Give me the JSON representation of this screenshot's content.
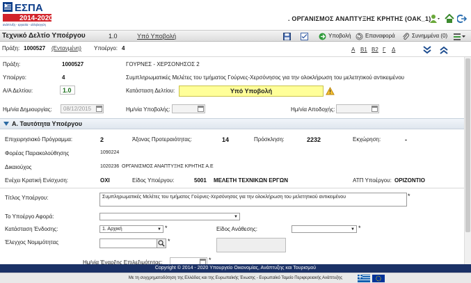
{
  "header": {
    "logo_text": "ΕΣΠΑ",
    "logo_years": "2014-2020",
    "logo_tagline": "ανάπτυξη - εργασία - αλληλεγγύη",
    "org_name": ". ΟΡΓΑΝΙΣΜΟΣ ΑΝΑΠΤΥΞΗΣ ΚΡΗΤΗΣ (OAK_1)",
    "icons": [
      "user-dropdown-icon",
      "home-icon",
      "logout-icon"
    ]
  },
  "toolbar": {
    "title": "Τεχνικό Δελτίο Υποέργου",
    "version": "1.0",
    "status_link": "Υπό Υποβολή",
    "submit_label": "Υποβολή",
    "resubmit_label": "Επαναφορά",
    "attachments_label": "Συνημμένα (0)"
  },
  "infobar": {
    "praxi_label": "Πράξη:",
    "praxi_value": "1000527",
    "praxi_link": "(Εντανμένη)",
    "ypoergo_label": "Υποέργο:",
    "ypoergo_value": "4",
    "section_links": [
      "A",
      "B1",
      "B2",
      "Γ",
      "Δ"
    ]
  },
  "details": {
    "praxi_label": "Πράξη:",
    "praxi_value": "1000527",
    "praxi_title": "ΓΟΥΡΝΕΣ - ΧΕΡΣΟΝΗΣΟΣ 2",
    "ypoergo_label": "Υποέργο:",
    "ypoergo_value": "4",
    "ypoergo_title": "Συμπληρωματικές Μελέτες του τμήματος Γούρνες-Χερσόνησος για την ολοκλήρωση του μελετητικού αντικειμένου",
    "ad_label": "Α/Α Δελτίου:",
    "ad_value": "1.0",
    "status_label": "Κατάσταση Δελτίου:",
    "status_value": "Υπό Υποβολή",
    "created_label": "Ημ/νία Δημιουργίας:",
    "created_value": "08/12/2015",
    "submitted_label": "Ημ/νία Υποβολής:",
    "accepted_label": "Ημ/νία Αποδοχής:"
  },
  "section_a": {
    "title": "Α. Ταυτότητα Υποέργου",
    "ep_label": "Επιχειρησιακό Πρόγραμμα:",
    "ep_value": "2",
    "axis_label": "Άξονας Προτεραιότητας:",
    "axis_value": "14",
    "call_label": "Πρόσκληση:",
    "call_value": "2232",
    "ekx_label": "Εκχώρηση:",
    "ekx_value": "-",
    "foreas_label": "Φορέας Παρακολούθησης",
    "foreas_value": "1090224",
    "dik_label": "Δικαιούχος",
    "dik_code": "1020236",
    "dik_name": "ΟΡΓΑΝΙΣΜΟΣ ΑΝΑΠΤΥΞΗΣ ΚΡΗΤΗΣ Α.Ε",
    "kratiki_label": "Ενέχει Κρατική Ενίσχυση:",
    "kratiki_value": "ΟΧΙ",
    "eidos_label": "Είδος Υποέργου:",
    "eidos_code": "5001",
    "eidos_value": "ΜΕΛΕΤΗ ΤΕΧΝΙΚΩΝ ΕΡΓΩΝ",
    "atp_label": "ΑΤΠ Υποέργου:",
    "atp_value": "ΟΡΙΖΟΝΤΙΟ"
  },
  "form": {
    "titlos_label": "Τίτλος Υποέργου:",
    "titlos_value": "Συμπληρωματικές Μελέτες του τμήματος Γούρνες-Χερσόνησος για την ολοκλήρωση του μελετητικού αντικειμένου",
    "afora_label": "Το Υποέργο Αφορά:",
    "afora_value": "",
    "katastasi_label": "Κατάσταση Ένδοσης:",
    "katastasi_value": "1. Αρχική",
    "anathesi_label": "Είδος Ανάθεσης:",
    "anathesi_value": "",
    "nomimotita_label": "Έλεγχος Νομιμότητας",
    "enarxi_label": "Ημ/νία Έναρξης Επιλεξιμότητας:"
  },
  "footer": {
    "copyright": "Copyright © 2014 - 2020 Υπουργείο Οικονομίας, Ανάπτυξης και Τουρισμού",
    "cofinance": "Με τη συγχρηματοδότηση της Ελλάδας και της Ευρωπαϊκής Ένωσης - Ευρωπαϊκό Ταμείο Περιφερειακής Ανάπτυξης"
  },
  "colors": {
    "status_yellow": "#ffff99",
    "footer_blue": "#1b3166",
    "logo_red": "#d2232a",
    "logo_blue": "#0d3e8a"
  }
}
